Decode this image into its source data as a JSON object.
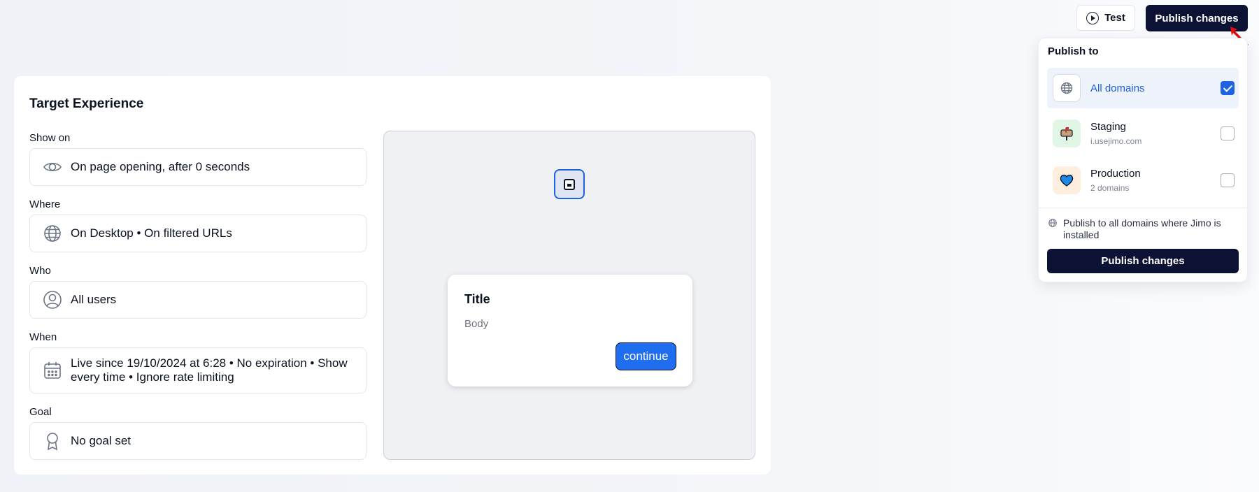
{
  "header": {
    "test_label": "Test",
    "publish_label": "Publish changes"
  },
  "publish_dropdown": {
    "title": "Publish to",
    "options": [
      {
        "name": "All domains",
        "sub": "",
        "checked": true,
        "icon": "globe-icon"
      },
      {
        "name": "Staging",
        "sub": "i.usejimo.com",
        "checked": false,
        "icon": "mailbox-icon"
      },
      {
        "name": "Production",
        "sub": "2 domains",
        "checked": false,
        "icon": "heart-icon"
      }
    ],
    "note": "Publish to all domains where Jimo is installed",
    "publish_label": "Publish changes"
  },
  "target_experience": {
    "title": "Target Experience",
    "fields": [
      {
        "label": "Show on",
        "value": "On page opening, after 0 seconds",
        "icon": "eye-icon"
      },
      {
        "label": "Where",
        "value": "On Desktop • On filtered URLs",
        "icon": "globe-icon"
      },
      {
        "label": "Who",
        "value": "All users",
        "icon": "user-circle-icon"
      },
      {
        "label": "When",
        "value": "Live since 19/10/2024 at 6:28 • No expiration • Show every time • Ignore rate limiting",
        "icon": "calendar-icon"
      },
      {
        "label": "Goal",
        "value": "No goal set",
        "icon": "award-icon"
      }
    ]
  },
  "preview": {
    "tooltip_title": "Title",
    "tooltip_body": "Body",
    "tooltip_button": "continue"
  },
  "colors": {
    "primary_dark": "#0b1233",
    "accent_blue": "#1e63e0",
    "preview_button": "#1f6ef0"
  }
}
